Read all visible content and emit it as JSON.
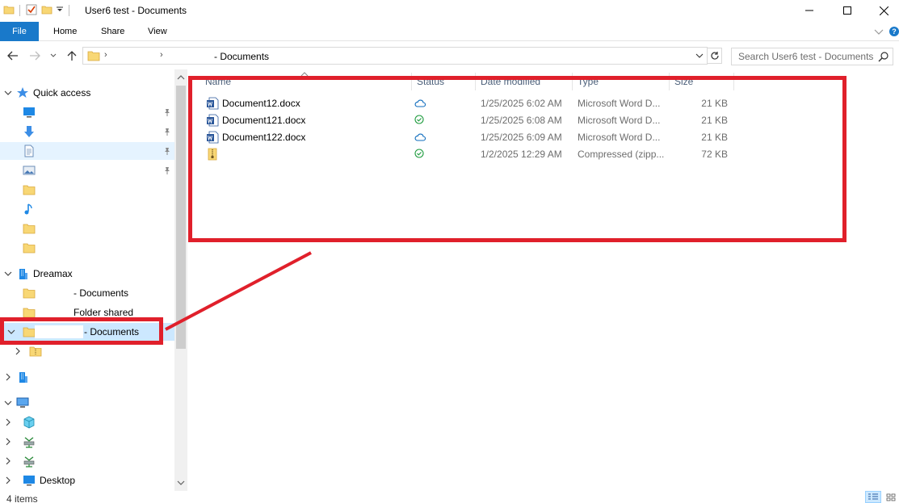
{
  "window": {
    "title": "User6 test - Documents"
  },
  "ribbon": {
    "tabs": [
      {
        "label": "File"
      },
      {
        "label": "Home"
      },
      {
        "label": "Share"
      },
      {
        "label": "View"
      }
    ]
  },
  "address": {
    "path": "- Documents",
    "separator": "›"
  },
  "search": {
    "placeholder": "Search User6 test - Documents"
  },
  "navpane": {
    "quick_access": "Quick access",
    "org": "Dreamax",
    "org_items": [
      {
        "label": "- Documents"
      },
      {
        "label": "Folder shared"
      },
      {
        "label": "- Documents"
      }
    ],
    "desktop": "Desktop"
  },
  "columns": {
    "name": "Name",
    "status": "Status",
    "date": "Date modified",
    "type": "Type",
    "size": "Size"
  },
  "files": [
    {
      "name": "Document12.docx",
      "status": "cloud",
      "date": "1/25/2025 6:02 AM",
      "type": "Microsoft Word D...",
      "size": "21 KB",
      "icon": "word-icon"
    },
    {
      "name": "Document121.docx",
      "status": "synced",
      "date": "1/25/2025 6:08 AM",
      "type": "Microsoft Word D...",
      "size": "21 KB",
      "icon": "word-icon"
    },
    {
      "name": "Document122.docx",
      "status": "cloud",
      "date": "1/25/2025 6:09 AM",
      "type": "Microsoft Word D...",
      "size": "21 KB",
      "icon": "word-icon"
    },
    {
      "name": "",
      "status": "synced",
      "date": "1/2/2025 12:29 AM",
      "type": "Compressed (zipp...",
      "size": "72 KB",
      "icon": "zip-icon"
    }
  ],
  "statusbar": {
    "item_count": "4 items"
  },
  "colors": {
    "accent": "#1979ca",
    "selection": "#cce8ff",
    "annotation": "#e0202b",
    "onedrive_blue": "#0f6cbd",
    "synced_green": "#1e9b3e"
  }
}
